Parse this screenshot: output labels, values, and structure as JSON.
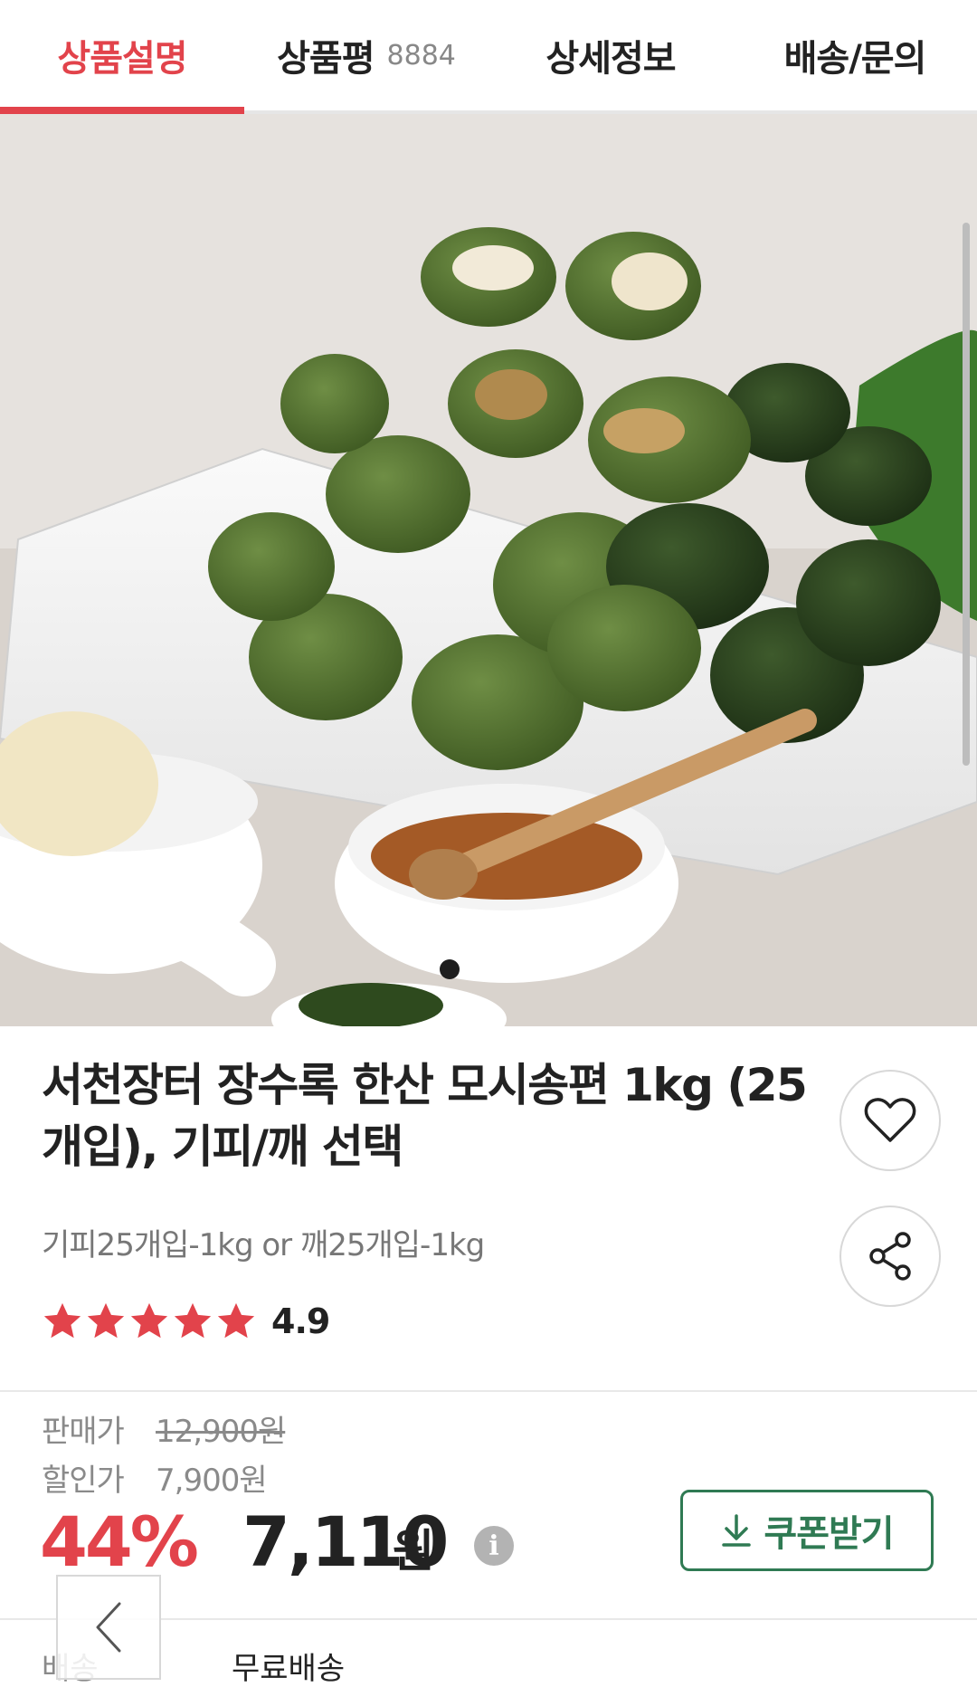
{
  "tabs": [
    {
      "label": "상품설명",
      "active": true
    },
    {
      "label": "상품평",
      "count": "8884",
      "active": false
    },
    {
      "label": "상세정보",
      "active": false
    },
    {
      "label": "배송/문의",
      "active": false
    }
  ],
  "hero": {
    "image_alt": "",
    "carousel_dots": [
      true,
      false
    ]
  },
  "product": {
    "title": "서천장터 장수록 한산 모시송편 1kg (25개입), 기피/깨 선택",
    "option_summary": "기피25개입-1kg or 깨25개입-1kg",
    "rating_value": "4.9",
    "stars": 5
  },
  "price": {
    "list_label": "판매가",
    "list_price": "12,900원",
    "sale_label": "할인가",
    "sale_price": "7,900원",
    "discount_rate": "44%",
    "final_price": "7,110",
    "final_unit": "원",
    "info_icon": "i",
    "coupon_label": "쿠폰받기"
  },
  "shipping": {
    "label": "배송",
    "value": "무료배송"
  },
  "icons": {
    "wishlist": "heart-icon",
    "share": "share-icon",
    "coupon": "download-icon",
    "back": "chevron-left-icon"
  },
  "colors": {
    "accent": "#e2434b",
    "coupon": "#2f7a53",
    "muted": "#8a8a8a"
  }
}
